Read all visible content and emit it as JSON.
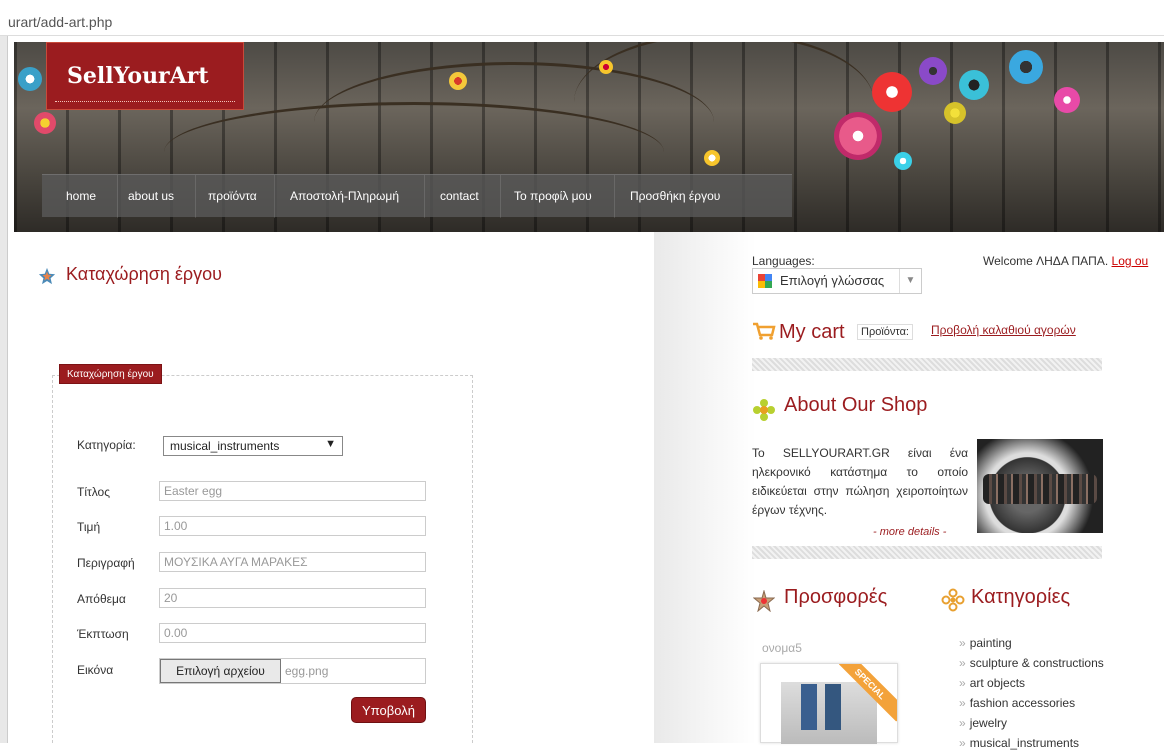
{
  "browser": {
    "url": "urart/add-art.php"
  },
  "site": {
    "logo": "SellYourArt"
  },
  "nav": [
    "home",
    "about us",
    "προϊόντα",
    "Αποστολή-Πληρωμή",
    "contact",
    "Το προφίλ μου",
    "Προσθήκη έργου"
  ],
  "page": {
    "title": "Καταχώρηση έργου"
  },
  "form": {
    "legend": "Καταχώρηση έργου",
    "category_label": "Κατηγορία:",
    "category_value": "musical_instruments",
    "fields": [
      {
        "label": "Τίτλος",
        "value": "Easter egg"
      },
      {
        "label": "Τιμή",
        "value": "1.00"
      },
      {
        "label": "Περιγραφή",
        "value": "ΜΟΥΣΙΚΑ ΑΥΓΑ ΜΑΡΑΚΕΣ"
      },
      {
        "label": "Απόθεμα",
        "value": "20"
      },
      {
        "label": "Έκπτωση",
        "value": "0.00"
      }
    ],
    "image_label": "Εικόνα",
    "file_button": "Επιλογή αρχείου",
    "file_name": "egg.png",
    "submit": "Υποβολή"
  },
  "sidebar": {
    "languages_label": "Languages:",
    "language_select": "Επιλογή γλώσσας",
    "welcome_text": "Welcome ΛΗΔΑ ΠΑΠΑ.",
    "logout": "Log ou",
    "cart_title": "My cart",
    "products_label": "Προϊόντα:",
    "cart_link": "Προβολή καλαθιού αγορών",
    "about_title": "About Our Shop",
    "about_text": "Το SELLYOURART.GR είναι ένα ηλεκρονικό κατάστημα το οποίο ειδικεύεται στην πώληση χειροποίητων έργων τέχνης.",
    "more_details": "- more details -",
    "offers_title": "Προσφορές",
    "categories_title": "Κατηγορίες",
    "offer_name": "ονομα5",
    "special": "SPECIAL",
    "categories": [
      "painting",
      "sculpture & constructions",
      "art objects",
      "fashion accessories",
      "jewelry",
      "musical_instruments"
    ]
  },
  "colors": {
    "brand": "#9b1c1f",
    "nav_bg": "#5a5a5a"
  }
}
